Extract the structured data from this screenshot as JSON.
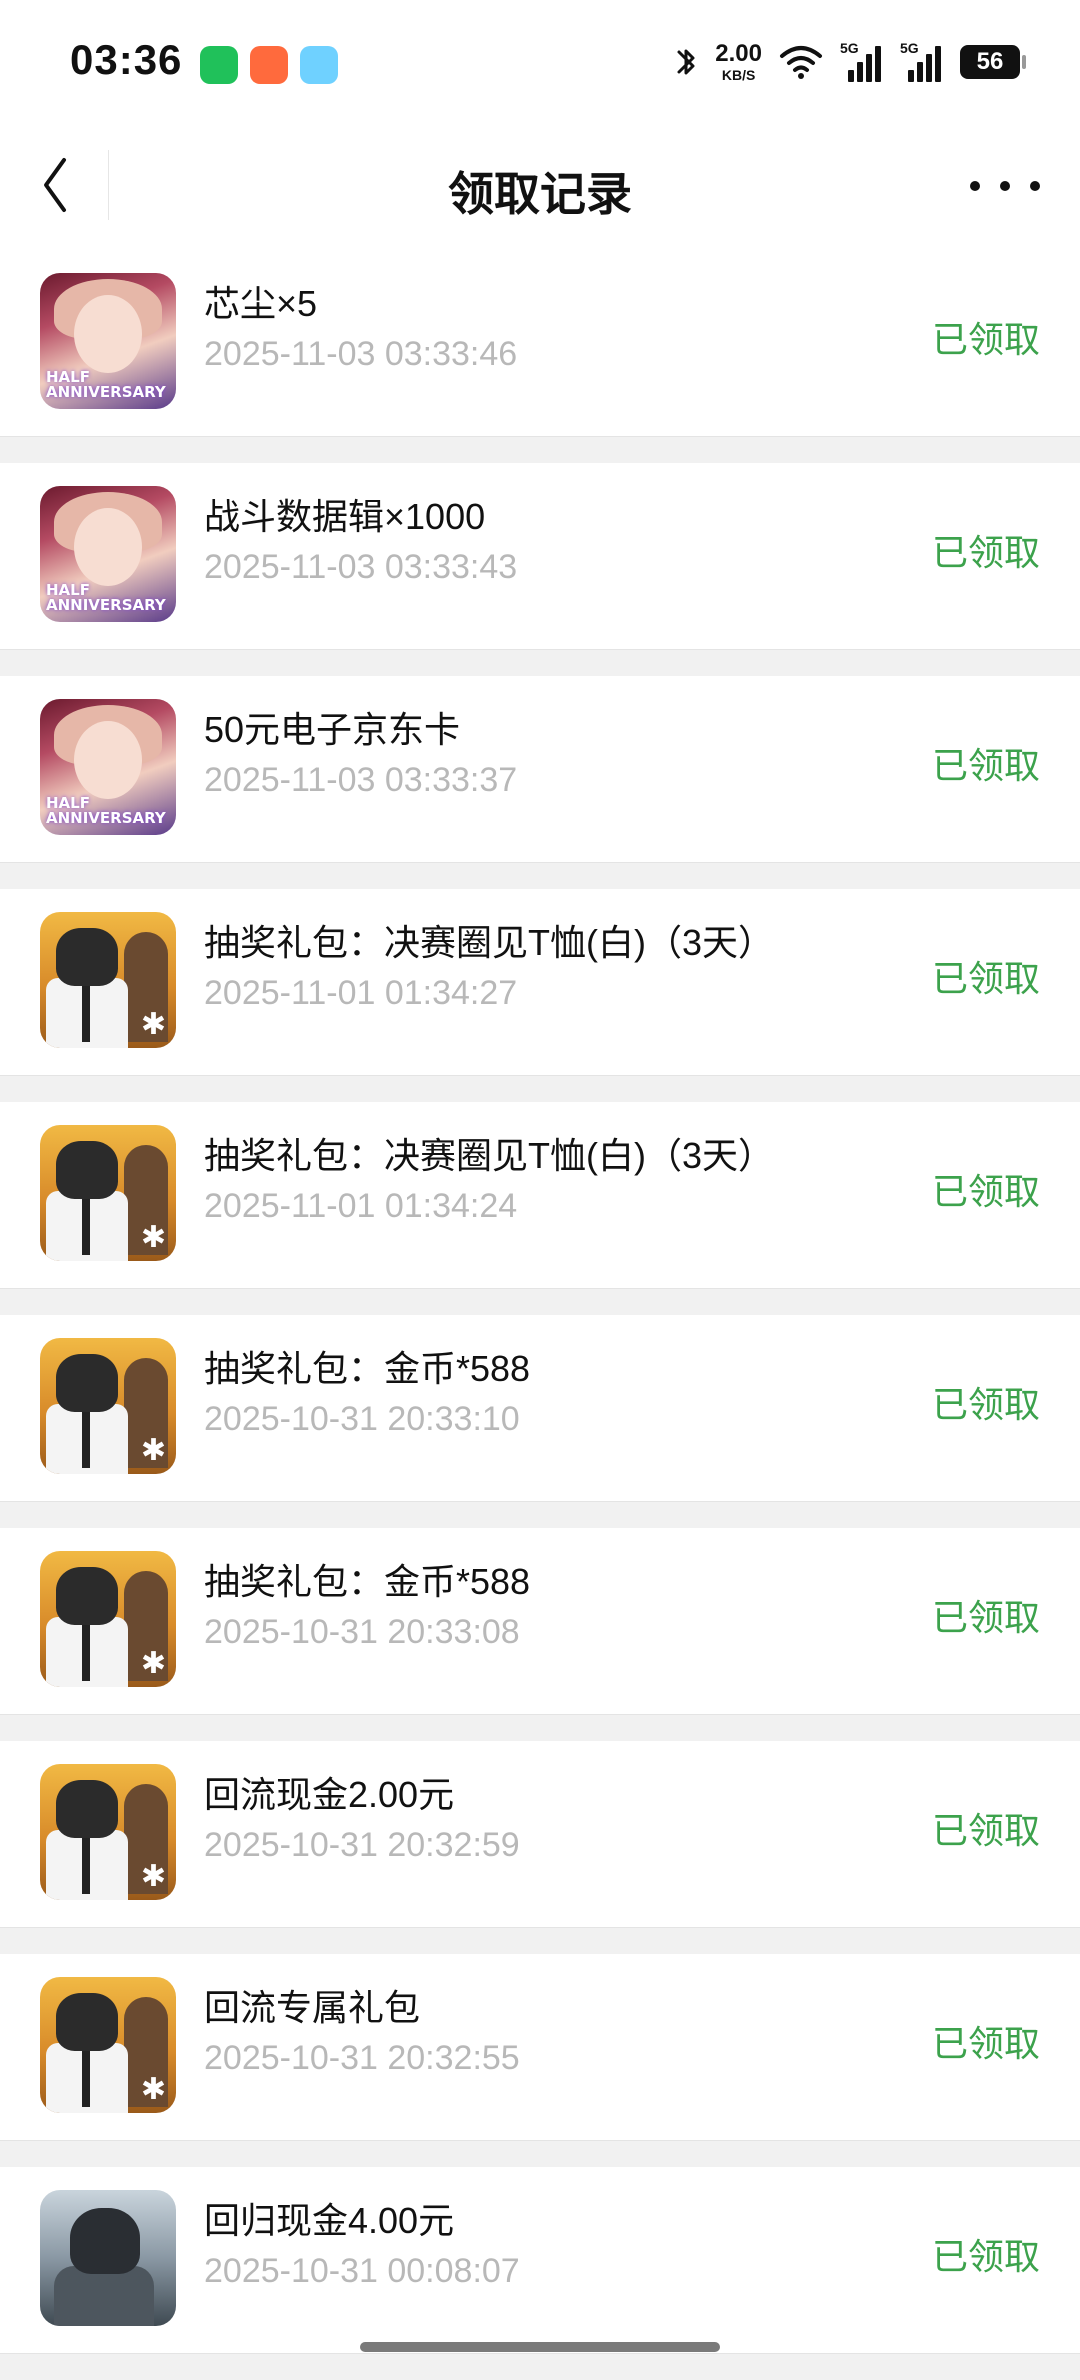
{
  "status_bar": {
    "time": "03:36",
    "net_speed_value": "2.00",
    "net_speed_unit": "KB/S",
    "signal1_label": "5G",
    "signal2_label": "5G",
    "battery": "56"
  },
  "nav": {
    "title": "领取记录",
    "back_icon": "chevron-left-icon",
    "more_icon": "more-dots-icon"
  },
  "records": [
    {
      "title": "芯尘×5",
      "time": "2025-11-03 03:33:46",
      "status": "已领取",
      "icon": "anime",
      "badge": "HALF\nANNIVERSARY"
    },
    {
      "title": "战斗数据辑×1000",
      "time": "2025-11-03 03:33:43",
      "status": "已领取",
      "icon": "anime",
      "badge": "HALF\nANNIVERSARY"
    },
    {
      "title": "50元电子京东卡",
      "time": "2025-11-03 03:33:37",
      "status": "已领取",
      "icon": "anime",
      "badge": "HALF\nANNIVERSARY"
    },
    {
      "title": "抽奖礼包：决赛圈见T恤(白)（3天）",
      "time": "2025-11-01 01:34:27",
      "status": "已领取",
      "icon": "pubg"
    },
    {
      "title": "抽奖礼包：决赛圈见T恤(白)（3天）",
      "time": "2025-11-01 01:34:24",
      "status": "已领取",
      "icon": "pubg"
    },
    {
      "title": "抽奖礼包：金币*588",
      "time": "2025-10-31 20:33:10",
      "status": "已领取",
      "icon": "pubg"
    },
    {
      "title": "抽奖礼包：金币*588",
      "time": "2025-10-31 20:33:08",
      "status": "已领取",
      "icon": "pubg"
    },
    {
      "title": "回流现金2.00元",
      "time": "2025-10-31 20:32:59",
      "status": "已领取",
      "icon": "pubg"
    },
    {
      "title": "回流专属礼包",
      "time": "2025-10-31 20:32:55",
      "status": "已领取",
      "icon": "pubg"
    },
    {
      "title": "回归现金4.00元",
      "time": "2025-10-31 00:08:07",
      "status": "已领取",
      "icon": "dark"
    }
  ]
}
